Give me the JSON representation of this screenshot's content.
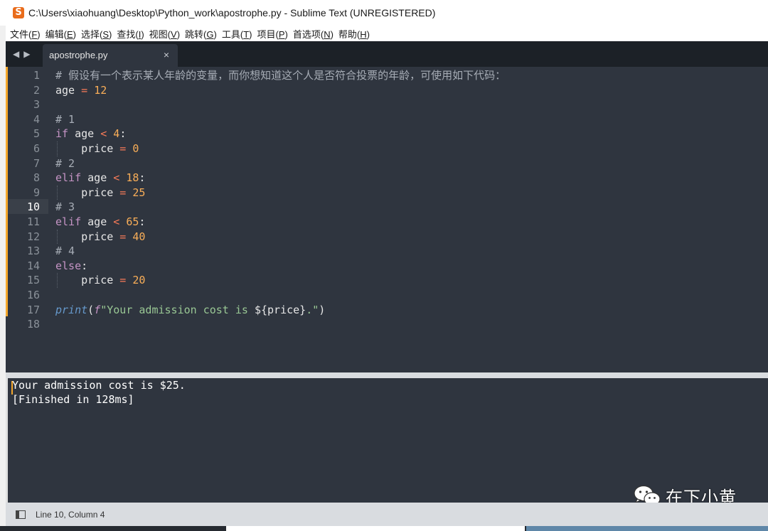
{
  "window": {
    "title": "C:\\Users\\xiaohuang\\Desktop\\Python_work\\apostrophe.py - Sublime Text (UNREGISTERED)"
  },
  "menu": [
    {
      "label": "文件(",
      "key": "F",
      "end": ")"
    },
    {
      "label": "编辑(",
      "key": "E",
      "end": ")"
    },
    {
      "label": "选择(",
      "key": "S",
      "end": ")"
    },
    {
      "label": "查找(",
      "key": "I",
      "end": ")"
    },
    {
      "label": "视图(",
      "key": "V",
      "end": ")"
    },
    {
      "label": "跳转(",
      "key": "G",
      "end": ")"
    },
    {
      "label": "工具(",
      "key": "T",
      "end": ")"
    },
    {
      "label": "项目(",
      "key": "P",
      "end": ")"
    },
    {
      "label": "首选项(",
      "key": "N",
      "end": ")"
    },
    {
      "label": "帮助(",
      "key": "H",
      "end": ")"
    }
  ],
  "tab": {
    "label": "apostrophe.py",
    "close": "×"
  },
  "editor": {
    "active_line": 10,
    "line_numbers": [
      "1",
      "2",
      "3",
      "4",
      "5",
      "6",
      "7",
      "8",
      "9",
      "10",
      "11",
      "12",
      "13",
      "14",
      "15",
      "16",
      "17",
      "18"
    ],
    "code": [
      [
        {
          "t": "# 假设有一个表示某人年龄的变量，而你想知道这个人是否符合投票的年龄，可使用如下代码：",
          "c": "cmt"
        }
      ],
      [
        {
          "t": "age",
          "c": "var"
        },
        {
          "t": " = ",
          "c": "op"
        },
        {
          "t": "12",
          "c": "num"
        }
      ],
      [],
      [
        {
          "t": "# 1",
          "c": "cmt"
        }
      ],
      [
        {
          "t": "if",
          "c": "kw"
        },
        {
          "t": " age ",
          "c": "var"
        },
        {
          "t": "<",
          "c": "op"
        },
        {
          "t": " 4",
          "c": "num"
        },
        {
          "t": ":",
          "c": "var"
        }
      ],
      [
        {
          "t": "    price",
          "c": "var"
        },
        {
          "t": " = ",
          "c": "op"
        },
        {
          "t": "0",
          "c": "num"
        }
      ],
      [
        {
          "t": "# 2",
          "c": "cmt"
        }
      ],
      [
        {
          "t": "elif",
          "c": "kw"
        },
        {
          "t": " age ",
          "c": "var"
        },
        {
          "t": "<",
          "c": "op"
        },
        {
          "t": " 18",
          "c": "num"
        },
        {
          "t": ":",
          "c": "var"
        }
      ],
      [
        {
          "t": "    price",
          "c": "var"
        },
        {
          "t": " = ",
          "c": "op"
        },
        {
          "t": "25",
          "c": "num"
        }
      ],
      [
        {
          "t": "# 3",
          "c": "cmt"
        }
      ],
      [
        {
          "t": "elif",
          "c": "kw"
        },
        {
          "t": " age ",
          "c": "var"
        },
        {
          "t": "<",
          "c": "op"
        },
        {
          "t": " 65",
          "c": "num"
        },
        {
          "t": ":",
          "c": "var"
        }
      ],
      [
        {
          "t": "    price",
          "c": "var"
        },
        {
          "t": " = ",
          "c": "op"
        },
        {
          "t": "40",
          "c": "num"
        }
      ],
      [
        {
          "t": "# 4",
          "c": "cmt"
        }
      ],
      [
        {
          "t": "else",
          "c": "kw"
        },
        {
          "t": ":",
          "c": "var"
        }
      ],
      [
        {
          "t": "    price",
          "c": "var"
        },
        {
          "t": " = ",
          "c": "op"
        },
        {
          "t": "20",
          "c": "num"
        }
      ],
      [],
      [
        {
          "t": "print",
          "c": "fn"
        },
        {
          "t": "(",
          "c": "var"
        },
        {
          "t": "f",
          "c": "fpre"
        },
        {
          "t": "\"Your admission cost is ",
          "c": "str"
        },
        {
          "t": "${price}",
          "c": "var"
        },
        {
          "t": ".\"",
          "c": "str"
        },
        {
          "t": ")",
          "c": "var"
        }
      ],
      []
    ]
  },
  "output": {
    "lines": [
      "Your admission cost is $25.",
      "[Finished in 128ms]"
    ]
  },
  "status": {
    "position": "Line 10, Column 4"
  },
  "watermark": {
    "text": "在下小黄"
  },
  "colors": {
    "editor_bg": "#2f353f",
    "comment": "#a6acb5",
    "keyword": "#c594c5",
    "operator": "#f97b58",
    "number": "#f9ae58",
    "function": "#6699cc",
    "string": "#99c794",
    "modified_marker": "#f4a72c"
  }
}
